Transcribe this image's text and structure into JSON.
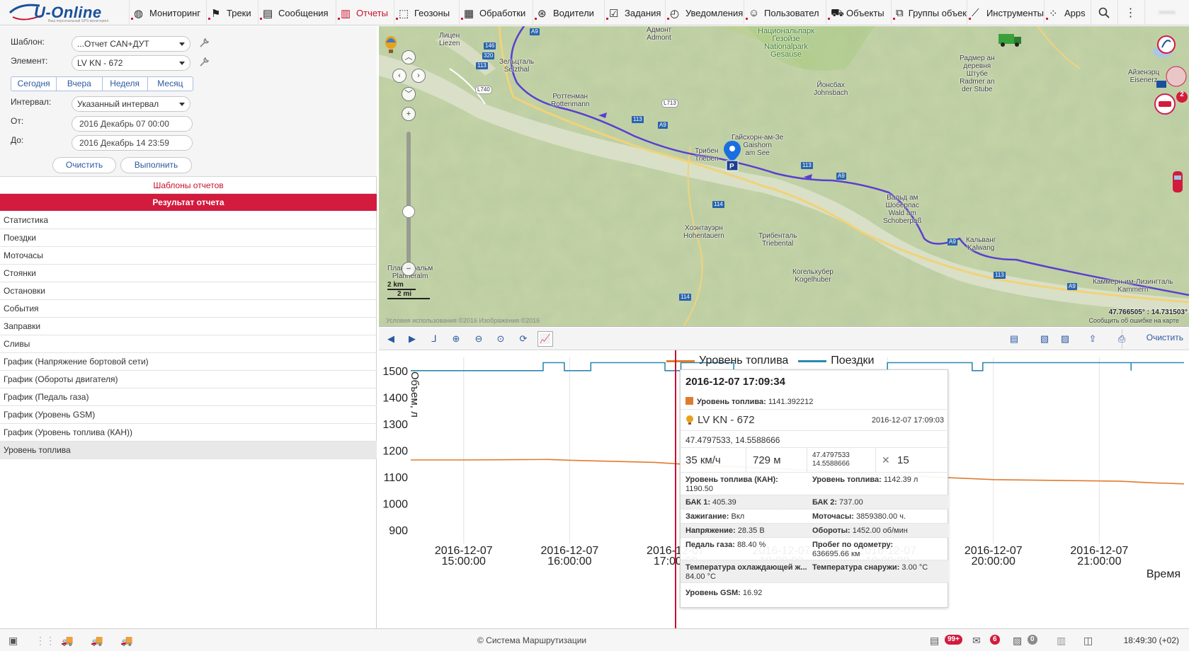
{
  "app": {
    "logo_text": "U-Online",
    "logo_tagline": "Ваш персональный GPS мониторинг"
  },
  "nav": {
    "items": [
      {
        "label": "Мониторинг",
        "icon": "globe-icon"
      },
      {
        "label": "Треки",
        "icon": "flag-icon"
      },
      {
        "label": "Сообщения",
        "icon": "messages-icon"
      },
      {
        "label": "Отчеты",
        "icon": "chart-icon",
        "active": true
      },
      {
        "label": "Геозоны",
        "icon": "geofence-icon"
      },
      {
        "label": "Обработки",
        "icon": "processing-icon"
      },
      {
        "label": "Водители",
        "icon": "steering-wheel-icon"
      },
      {
        "label": "Задания",
        "icon": "tasks-icon"
      },
      {
        "label": "Уведомления",
        "icon": "notification-icon"
      },
      {
        "label": "Пользовател",
        "icon": "user-icon"
      },
      {
        "label": "Объекты",
        "icon": "car-icon"
      },
      {
        "label": "Группы объек",
        "icon": "group-icon"
      },
      {
        "label": "Инструменты",
        "icon": "tools-icon"
      },
      {
        "label": "Apps",
        "icon": "apps-grid-icon"
      }
    ],
    "user": "••••••"
  },
  "form": {
    "template_label": "Шаблон:",
    "template_value": "...Отчет CAN+ДУТ",
    "element_label": "Элемент:",
    "element_value": "LV KN - 672",
    "periods": [
      "Сегодня",
      "Вчера",
      "Неделя",
      "Месяц"
    ],
    "interval_label": "Интервал:",
    "interval_value": "Указанный интервал",
    "from_label": "От:",
    "from_value": "2016 Декабрь 07 00:00",
    "to_label": "До:",
    "to_value": "2016 Декабрь 14 23:59",
    "clear_label": "Очистить",
    "execute_label": "Выполнить"
  },
  "templates_header": "Шаблоны отчетов",
  "result_header": "Результат отчета",
  "report_items": [
    "Статистика",
    "Поездки",
    "Моточасы",
    "Стоянки",
    "Остановки",
    "События",
    "Заправки",
    "Сливы",
    "График (Напряжение бортовой сети)",
    "График (Обороты двигателя)",
    "График (Педаль газа)",
    "График (Уровень GSM)",
    "График (Уровень топлива (КАН))",
    "Уровень топлива"
  ],
  "map": {
    "labels": {
      "liezen": "Лицен\nLiezen",
      "selzthal": "Зельцталь\nSelzthal",
      "admont": "Адмонт\nAdmont",
      "park": "Национальпарк\nГезойзе\nNationalpark\nGesause",
      "rottenmann": "Роттенман\nRottenmann",
      "johnsbach": "Йонсбах\nJohnsbach",
      "radmer": "Радмер ан\nдеревня\nШтубе\nRadmer an\nder Stube",
      "eisenerz": "Айзенэрц\nEisenerz",
      "gaishorn": "Гайсхорн-ам-Зе\nGaishorn\nam See",
      "trieben": "Трибен\nTrieben",
      "wald": "Вальд ам\nШоберпас\nWald am\nSchoberpaß",
      "hohentauern": "Хоэнтауэрн\nHohentauern",
      "triebental": "Трибенталь\nTriebental",
      "kalwang": "Кальванг\nKalwang",
      "kogelhuber": "Когельхубер\nKogelhuber",
      "planneralm": "Планнеральм\nPlanneralm",
      "kammern": "Каммерн-им-Лизингталь\nKammern"
    },
    "roads": [
      "A9",
      "146",
      "320",
      "113",
      "L740",
      "L713",
      "113",
      "A9",
      "113",
      "114",
      "A9",
      "A9",
      "113",
      "A9",
      "114"
    ],
    "coords": "47.766505° : 14.731503°",
    "report_error": "Сообщить об ошибке на карте",
    "copyright": "Условия использования  ©2016 Изображения ©2016",
    "scale_km": "2 km",
    "scale_mi": "2 mi",
    "alert_count": "2"
  },
  "chart_toolbar": {
    "clear_label": "Очистить"
  },
  "chart_data": {
    "type": "line",
    "xlabel": "Время",
    "ylabel": "Объем, л",
    "ylim": [
      850,
      1550
    ],
    "yticks": [
      900,
      1000,
      1100,
      1200,
      1300,
      1400,
      1500
    ],
    "xlim_hours": [
      14.5,
      21.8
    ],
    "xticks": [
      {
        "h": 15,
        "date": "2016-12-07",
        "time": "15:00:00"
      },
      {
        "h": 16,
        "date": "2016-12-07",
        "time": "16:00:00"
      },
      {
        "h": 17,
        "date": "2016-12-07",
        "time": "17:00:00"
      },
      {
        "h": 18,
        "date": "2016-12-07",
        "time": "18:00:00"
      },
      {
        "h": 19,
        "date": "2016-12-07",
        "time": "19:00:00"
      },
      {
        "h": 20,
        "date": "2016-12-07",
        "time": "20:00:00"
      },
      {
        "h": 21,
        "date": "2016-12-07",
        "time": "21:00:00"
      }
    ],
    "series": [
      {
        "name": "Уровень топлива",
        "color": "#e07b2e",
        "points": [
          [
            14.5,
            1164
          ],
          [
            15.0,
            1164
          ],
          [
            15.5,
            1165
          ],
          [
            15.8,
            1166
          ],
          [
            16.0,
            1163
          ],
          [
            16.2,
            1161
          ],
          [
            16.5,
            1158
          ],
          [
            16.8,
            1155
          ],
          [
            17.0,
            1150
          ],
          [
            17.2,
            1145
          ],
          [
            17.4,
            1141
          ],
          [
            17.6,
            1138
          ],
          [
            18.0,
            1130
          ],
          [
            18.4,
            1122
          ],
          [
            18.8,
            1112
          ],
          [
            19.2,
            1104
          ],
          [
            19.6,
            1097
          ],
          [
            20.0,
            1090
          ],
          [
            20.4,
            1088
          ],
          [
            20.8,
            1086
          ],
          [
            21.2,
            1084
          ],
          [
            21.5,
            1078
          ],
          [
            21.8,
            1074
          ]
        ]
      },
      {
        "name": "Поездки",
        "color": "#2c88b0",
        "points": [
          [
            14.5,
            1500
          ],
          [
            15.75,
            1500
          ],
          [
            15.75,
            1530
          ],
          [
            15.95,
            1530
          ],
          [
            15.95,
            1500
          ],
          [
            16.2,
            1500
          ],
          [
            16.2,
            1530
          ],
          [
            16.9,
            1530
          ],
          [
            16.9,
            1500
          ],
          [
            17.05,
            1500
          ],
          [
            17.05,
            1530
          ],
          [
            17.55,
            1530
          ],
          [
            17.55,
            1500
          ],
          [
            19.0,
            1500
          ],
          [
            19.0,
            1530
          ],
          [
            19.8,
            1530
          ],
          [
            19.8,
            1500
          ],
          [
            19.9,
            1500
          ],
          [
            19.9,
            1530
          ],
          [
            21.3,
            1530
          ],
          [
            21.3,
            1500
          ],
          [
            21.3,
            1530
          ],
          [
            21.8,
            1530
          ]
        ]
      }
    ]
  },
  "tooltip": {
    "datetime": "2016-12-07 17:09:34",
    "fuel_label": "Уровень топлива:",
    "fuel_value": "1141.392212",
    "unit": "LV KN - 672",
    "msg_time": "2016-12-07 17:09:03",
    "position": "47.4797533, 14.5588666",
    "speed": "35 км/ч",
    "altitude": "729 м",
    "lat": "47.4797533",
    "lon": "14.5588666",
    "satellites": "15",
    "can_fuel_label": "Уровень топлива (КАН):",
    "can_fuel_value": "1190.50",
    "fuel_level_label": "Уровень топлива:",
    "fuel_level_value": "1142.39 л",
    "tank1_label": "БАК 1:",
    "tank1_value": "405.39",
    "tank2_label": "БАК 2:",
    "tank2_value": "737.00",
    "ignition_label": "Зажигание:",
    "ignition_value": "Вкл",
    "engine_hours_label": "Моточасы:",
    "engine_hours_value": "3859380.00 ч.",
    "voltage_label": "Напряжение:",
    "voltage_value": "28.35 В",
    "rpm_label": "Обороты:",
    "rpm_value": "1452.00 об/мин",
    "pedal_label": "Педаль газа:",
    "pedal_value": "88.40 %",
    "odometer_label": "Пробег по одометру:",
    "odometer_value": "636695.66 км",
    "coolant_label": "Температура охлаждающей ж...",
    "coolant_value": "84.00 °C",
    "outside_label": "Температура снаружи:",
    "outside_value": "3.00 °C",
    "gsm_label": "Уровень GSM:",
    "gsm_value": "16.92"
  },
  "status": {
    "footer": "© Система Маршрутизации",
    "messages_badge": "99+",
    "notifications_badge": "6",
    "events_badge": "0",
    "clock": "18:49:30 (+02)"
  }
}
